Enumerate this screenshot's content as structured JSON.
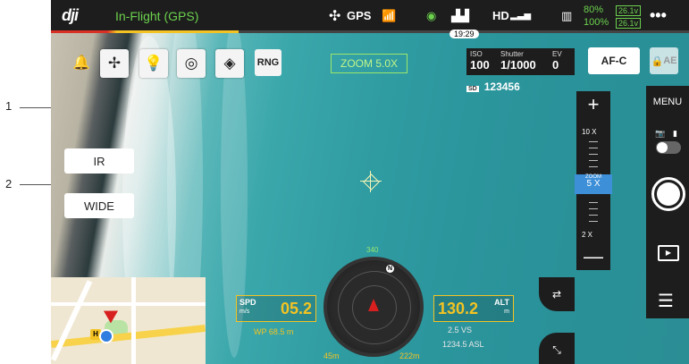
{
  "callouts": [
    {
      "label": "1"
    },
    {
      "label": "2"
    }
  ],
  "topbar": {
    "logo": "dji",
    "flight_status": "In-Flight (GPS)",
    "gps_label": "GPS",
    "hd_label": "HD",
    "flight_time": "19:29",
    "battery_aircraft": "80%",
    "battery_rc": "100%",
    "voltage_1": "26.1v",
    "voltage_2": "26.1v",
    "more_label": "•••"
  },
  "toolbar": {
    "rng_label": "RNG",
    "zoom_label": "ZOOM 5.0X"
  },
  "exposure": {
    "iso_label": "ISO",
    "iso_value": "100",
    "shutter_label": "Shutter",
    "shutter_value": "1/1000",
    "ev_label": "EV",
    "ev_value": "0"
  },
  "focus_mode": "AF-C",
  "ae_label": "AE",
  "storage": {
    "sd_label": "SD",
    "count": "123456"
  },
  "camera_modes": {
    "ir": "IR",
    "wide": "WIDE"
  },
  "zoom_slider": {
    "plus": "+",
    "minus": "—",
    "top_label": "10 X",
    "current_caption": "ZOOM",
    "current_value": "5 X",
    "bottom_label": "2 X",
    "level": 0.5
  },
  "right_panel": {
    "menu_label": "MENU"
  },
  "telemetry": {
    "spd_key": "SPD",
    "spd_unit": "m/s",
    "spd_value": "05.2",
    "alt_key": "ALT",
    "alt_unit": "m",
    "alt_value": "130.2",
    "vs_value": "2.5 VS",
    "asl_value": "1234.5 ASL",
    "dist_value": "WP 68.5 m",
    "heading": "340",
    "home_distance": "45m",
    "waypoint_distance": "222m"
  },
  "colors": {
    "accent_green": "#6cd24e",
    "warning_yellow": "#f3c323",
    "panel_dark": "#1d1d1d",
    "zoom_blue": "#3d8fd8"
  }
}
